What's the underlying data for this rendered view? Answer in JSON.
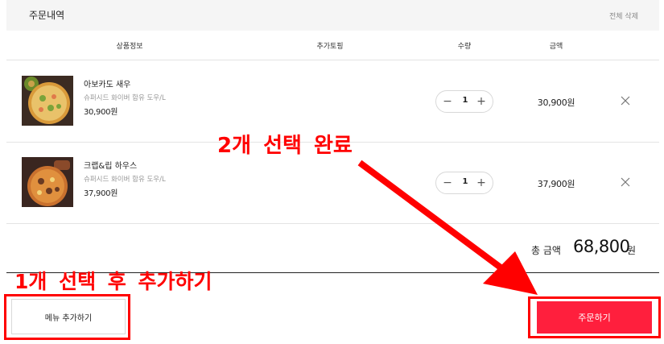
{
  "header": {
    "title": "주문내역",
    "clear_all": "전체 삭제"
  },
  "columns": {
    "product": "상품정보",
    "topping": "추가토핑",
    "quantity": "수량",
    "amount": "금액"
  },
  "items": [
    {
      "name": "아보카도 새우",
      "option": "슈퍼시드 화이버 함유 도우/L",
      "price": "30,900원",
      "qty": "1",
      "line_total": "30,900원"
    },
    {
      "name": "크랩&립 하우스",
      "option": "슈퍼시드 화이버 함유 도우/L",
      "price": "37,900원",
      "qty": "1",
      "line_total": "37,900원"
    }
  ],
  "stepper": {
    "minus": "−",
    "plus": "+"
  },
  "summary": {
    "label": "총 금액",
    "amount": "68,800",
    "unit": "원"
  },
  "buttons": {
    "add_menu": "메뉴 추가하기",
    "order": "주문하기"
  },
  "annotations": {
    "top": "2개 선택 완료",
    "bottom": "1개 선택 후 추가하기"
  },
  "colors": {
    "accent": "#ff1f3d",
    "annotation": "#ff0000",
    "header_bg": "#f5f5f5"
  },
  "icons": {
    "remove": "close-icon",
    "decrease": "minus-icon",
    "increase": "plus-icon"
  }
}
